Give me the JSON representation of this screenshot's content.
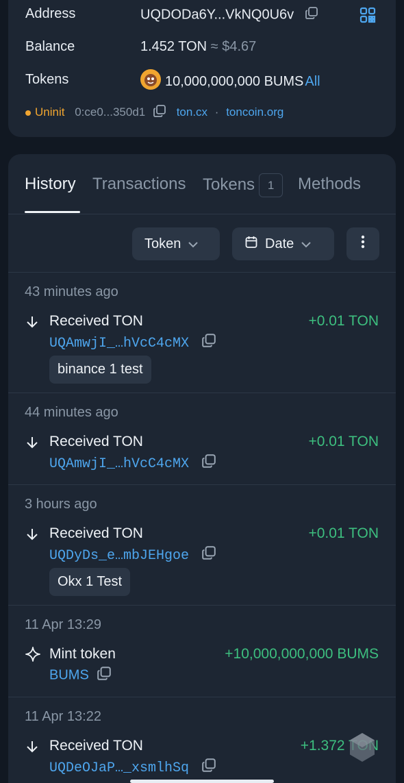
{
  "wallet": {
    "address_label": "Address",
    "address_value": "UQDODa6Y...VkNQ0U6v",
    "balance_label": "Balance",
    "balance_value": "1.452 TON",
    "balance_fiat": "≈ $4.67",
    "tokens_label": "Tokens",
    "tokens_value": "10,000,000,000 BUMS",
    "tokens_all": "All",
    "status": "Uninit",
    "raw_address": "0:ce0...350d1",
    "link1": "ton.cx",
    "separator": "·",
    "link2": "toncoin.org"
  },
  "tabs": [
    {
      "label": "History"
    },
    {
      "label": "Transactions"
    },
    {
      "label": "Tokens",
      "count": "1"
    },
    {
      "label": "Methods"
    }
  ],
  "filters": {
    "token_label": "Token",
    "date_label": "Date"
  },
  "history": [
    {
      "time": "43 minutes ago",
      "title": "Received TON",
      "amount": "+0.01 TON",
      "address": "UQAmwjI_…hVcC4cMX",
      "comment": "binance 1 test"
    },
    {
      "time": "44 minutes ago",
      "title": "Received TON",
      "amount": "+0.01 TON",
      "address": "UQAmwjI_…hVcC4cMX"
    },
    {
      "time": "3 hours ago",
      "title": "Received TON",
      "amount": "+0.01 TON",
      "address": "UQDyDs_e…mbJEHgoe",
      "comment": "Okx 1 Test"
    },
    {
      "time": "11 Apr 13:29",
      "title": "Mint token",
      "amount": "+10,000,000,000 BUMS",
      "address": "BUMS"
    },
    {
      "time": "11 Apr 13:22",
      "title": "Received TON",
      "amount": "+1.372 TON",
      "address": "UQDeOJaP…_xsmlhSq"
    }
  ],
  "colors": {
    "background": "#111822",
    "card": "#1d2633",
    "accent": "#4ea6ee",
    "positive": "#3dbf7f",
    "warning": "#f0a530"
  }
}
